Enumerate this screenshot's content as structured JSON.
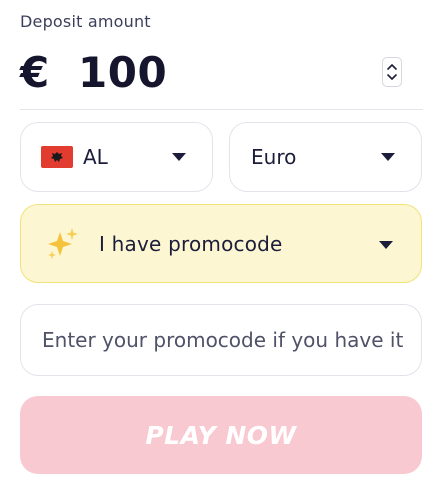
{
  "deposit": {
    "label": "Deposit amount",
    "currency_symbol": "€",
    "amount": "100",
    "stepper_icon": "up-down-arrows-icon"
  },
  "country_select": {
    "flag_icon": "albania-flag-icon",
    "value": "AL"
  },
  "currency_select": {
    "value": "Euro"
  },
  "promo": {
    "toggle_label": "I have promocode",
    "sparkle_icon": "sparkles-icon",
    "input_placeholder": "Enter your promocode if you have it"
  },
  "play_button": {
    "label": "PLAY NOW"
  },
  "colors": {
    "promo_background": "#fdf6d3",
    "promo_border": "#f1e27a",
    "play_button_background": "#f9c9d1",
    "text_dark": "#1c1d3a",
    "flag_red": "#e23b30"
  }
}
